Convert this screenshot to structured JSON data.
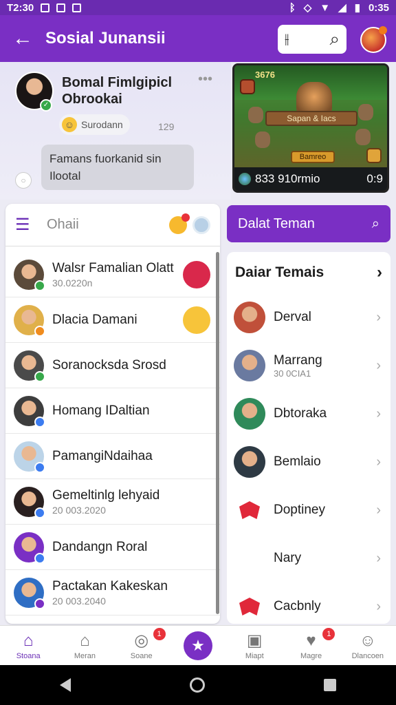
{
  "status_bar": {
    "left_text": "T2:30",
    "time": "0:35"
  },
  "app_bar": {
    "back": "←",
    "title": "Sosial Junansii",
    "search_glyph": "⌕",
    "filter_glyph": "⫲"
  },
  "profile": {
    "name": "Bomal Fimlgipicl Obrookai",
    "chip_label": "Surodann",
    "count": "129",
    "message": "Famans fuorkanid sin Ilootal",
    "more": "•••"
  },
  "game": {
    "title": "3676",
    "banner": "Sapan & Iacs",
    "button": "Bamreo",
    "score": "833 910rmio",
    "timer": "0:9"
  },
  "list": {
    "search_placeholder": "Ohaii",
    "rows": [
      {
        "name": "Walsr Famalian Olatt",
        "sub": "30.0220n",
        "avatar": "#5b4a3a",
        "status": "#37a84a",
        "action": "#d9284b"
      },
      {
        "name": "Dlacia Damani",
        "sub": "",
        "avatar": "#e0b04a",
        "status": "#f08c1e",
        "action": "#f7c43a"
      },
      {
        "name": "Soranocksda Srosd",
        "sub": "",
        "avatar": "#4a4a4a",
        "status": "#37a84a",
        "action": ""
      },
      {
        "name": "Homang IDaltian",
        "sub": "",
        "avatar": "#3d3d3d",
        "status": "#3c7cf0",
        "action": ""
      },
      {
        "name": "PamangiNdaihaa",
        "sub": "",
        "avatar": "#bcd4e8",
        "status": "#3c7cf0",
        "action": ""
      },
      {
        "name": "Gemeltinlg lehyaid",
        "sub": "20 003.2020",
        "avatar": "#2a2020",
        "status": "#3c7cf0",
        "action": ""
      },
      {
        "name": "Dandangn Roral",
        "sub": "",
        "avatar": "#7a2fc4",
        "status": "#3c7cf0",
        "action": ""
      },
      {
        "name": "Pactakan Kakeskan",
        "sub": "20 003.2040",
        "avatar": "#2f6ec4",
        "status": "#7a2fc4",
        "action": ""
      }
    ]
  },
  "friends": {
    "button_label": "Dalat Teman",
    "card_title": "Daiar Temais",
    "items": [
      {
        "name": "Derval",
        "sub": "",
        "avatar": "#c0503a"
      },
      {
        "name": "Marrang",
        "sub": "30 0CIA1",
        "avatar": "#6a7aa0"
      },
      {
        "name": "Dbtoraka",
        "sub": "",
        "avatar": "#2f8a5a"
      },
      {
        "name": "Bemlaio",
        "sub": "",
        "avatar": "#2e3a44"
      },
      {
        "name": "Doptiney",
        "sub": "",
        "avatar": "ribbon"
      },
      {
        "name": "Nary",
        "sub": "",
        "avatar": "none"
      },
      {
        "name": "Cacbnly",
        "sub": "",
        "avatar": "ribbon"
      }
    ]
  },
  "bottom_nav": [
    {
      "label": "Stoana",
      "icon": "⌂",
      "badge": "",
      "active": true
    },
    {
      "label": "Meran",
      "icon": "⌂",
      "badge": "",
      "active": false
    },
    {
      "label": "Soane",
      "icon": "◎",
      "badge": "1",
      "active": false
    },
    {
      "label": "",
      "icon": "★",
      "badge": "",
      "active": false,
      "fab": true
    },
    {
      "label": "Miapt",
      "icon": "▣",
      "badge": "",
      "active": false
    },
    {
      "label": "Magre",
      "icon": "♥",
      "badge": "1",
      "active": false
    },
    {
      "label": "Dlancoen",
      "icon": "☺",
      "badge": "",
      "active": false
    }
  ],
  "colors": {
    "primary": "#7a2fc4",
    "badge": "#e8323a"
  }
}
